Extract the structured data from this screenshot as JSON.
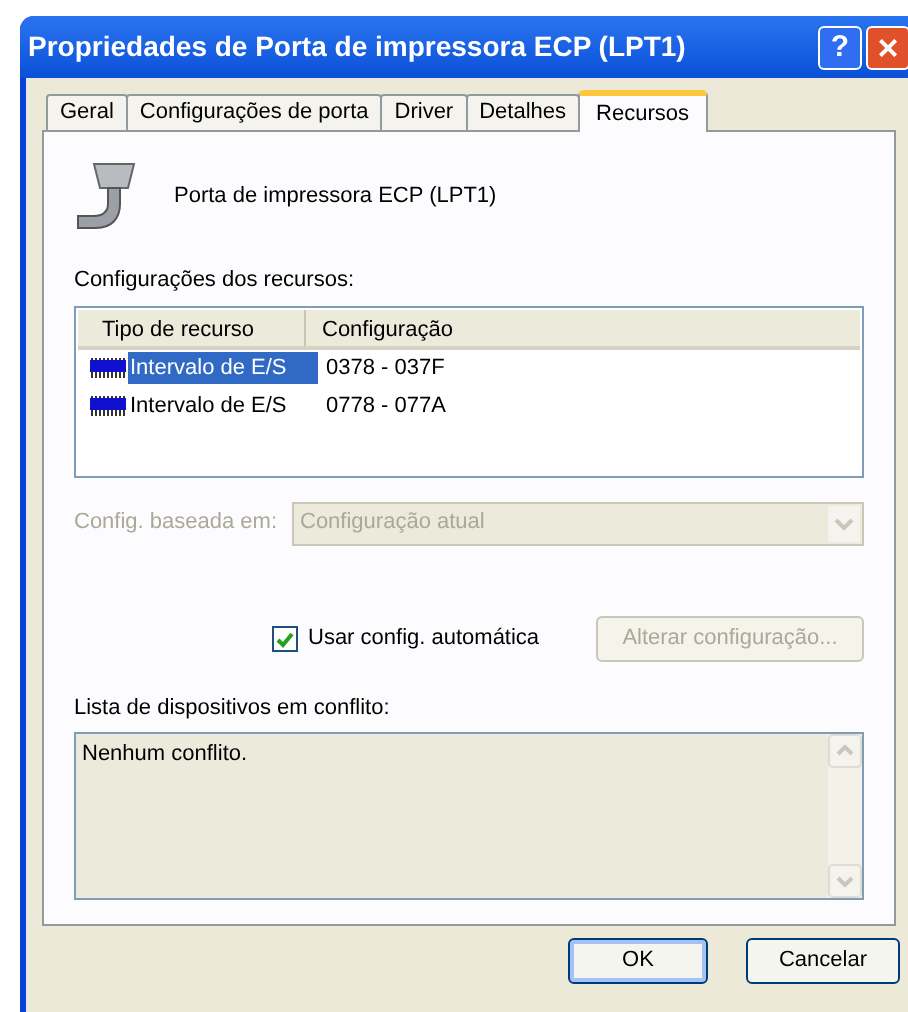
{
  "window": {
    "title": "Propriedades de Porta de impressora ECP (LPT1)",
    "help": "?",
    "close": "×"
  },
  "tabs": [
    {
      "label": "Geral",
      "selected": false
    },
    {
      "label": "Configurações de porta",
      "selected": false
    },
    {
      "label": "Driver",
      "selected": false
    },
    {
      "label": "Detalhes",
      "selected": false
    },
    {
      "label": "Recursos",
      "selected": true
    }
  ],
  "device_name": "Porta de impressora ECP (LPT1)",
  "resources_label": "Configurações dos recursos:",
  "table": {
    "columns": [
      "Tipo de recurso",
      "Configuração"
    ],
    "rows": [
      {
        "type": "Intervalo de E/S",
        "setting": "0378 - 037F",
        "selected": true
      },
      {
        "type": "Intervalo de E/S",
        "setting": "0778 - 077A",
        "selected": false
      }
    ]
  },
  "based_on": {
    "label": "Config. baseada em:",
    "value": "Configuração atual",
    "disabled": true
  },
  "auto_config": {
    "label": "Usar config. automática",
    "checked": true
  },
  "change_button": {
    "label": "Alterar configuração...",
    "disabled": true
  },
  "conflicts": {
    "label": "Lista de dispositivos em conflito:",
    "text": "Nenhum conflito."
  },
  "buttons": [
    "OK",
    "Cancelar"
  ]
}
